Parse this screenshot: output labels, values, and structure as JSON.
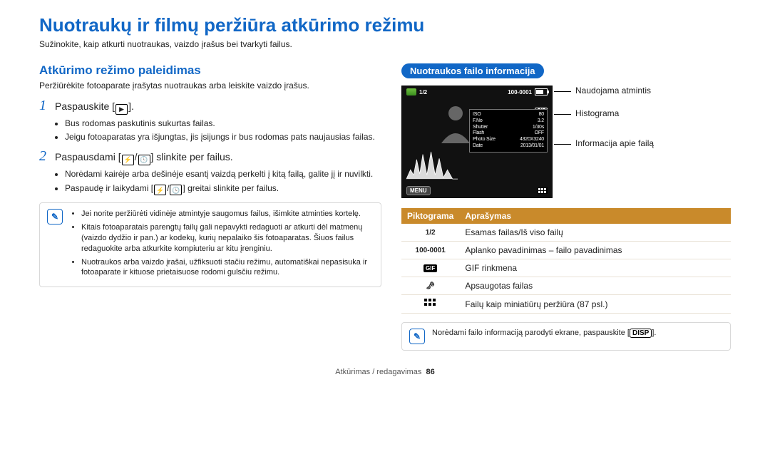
{
  "title": "Nuotraukų ir filmų peržiūra atkūrimo režimu",
  "subtitle": "Sužinokite, kaip atkurti nuotraukas, vaizdo įrašus bei tvarkyti failus.",
  "section": {
    "head": "Atkūrimo režimo paleidimas",
    "desc": "Peržiūrėkite fotoaparate įrašytas nuotraukas arba leiskite vaizdo įrašus."
  },
  "step1": {
    "pre": "Paspauskite [",
    "post": "].",
    "b1": "Bus rodomas paskutinis sukurtas failas.",
    "b2": "Jeigu fotoaparatas yra išjungtas, jis įsijungs ir bus rodomas pats naujausias failas."
  },
  "step2": {
    "pre": "Paspausdami [",
    "mid": "/",
    "post": "] slinkite per failus.",
    "b1": "Norėdami kairėje arba dešinėje esantį vaizdą perkelti į kitą failą, galite jį ir nuvilkti.",
    "b2pre": "Paspaudę ir laikydami [",
    "b2mid": "/",
    "b2post": "] greitai slinkite per failus."
  },
  "notes": {
    "n1": "Jei norite peržiūrėti vidinėje atmintyje saugomus failus, išimkite atminties kortelę.",
    "n2": "Kitais fotoaparatais parengtų failų gali nepavykti redaguoti ar atkurti dėl matmenų (vaizdo dydžio ir pan.) ar kodekų, kurių nepalaiko šis fotoaparatas. Šiuos failus redaguokite arba atkurkite kompiuteriu ar kitu įrenginiu.",
    "n3": "Nuotraukos arba vaizdo įrašai, užfiksuoti stačiu režimu, automatiškai nepasisuka ir fotoaparate ir kituose prietaisuose rodomi gulsčiu režimu."
  },
  "pill": "Nuotraukos failo informacija",
  "screen": {
    "counter": "1/2",
    "fileno": "100-0001",
    "menu": "MENU",
    "info": {
      "iso_l": "ISO",
      "iso_v": "80",
      "fno_l": "F.No",
      "fno_v": "3.2",
      "sh_l": "Shutter",
      "sh_v": "1/30s",
      "fl_l": "Flash",
      "fl_v": "OFF",
      "ps_l": "Photo Size",
      "ps_v": "4320X3240",
      "dt_l": "Date",
      "dt_v": "2013/01/01"
    }
  },
  "callouts": {
    "c1": "Naudojama atmintis",
    "c2": "Histograma",
    "c3": "Informacija apie failą"
  },
  "table": {
    "h1": "Piktograma",
    "h2": "Aprašymas",
    "r1i": "1/2",
    "r1": "Esamas failas/Iš viso failų",
    "r2i": "100-0001",
    "r2": "Aplanko pavadinimas – failo pavadinimas",
    "r3": "GIF rinkmena",
    "r4": "Apsaugotas failas",
    "r5": "Failų kaip miniatiūrų peržiūra (87 psl.)"
  },
  "note2": {
    "pre": "Norėdami failo informaciją parodyti ekrane, paspauskite [",
    "chip": "DISP",
    "post": "]."
  },
  "footer": {
    "chapter": "Atkūrimas / redagavimas",
    "page": "86"
  }
}
